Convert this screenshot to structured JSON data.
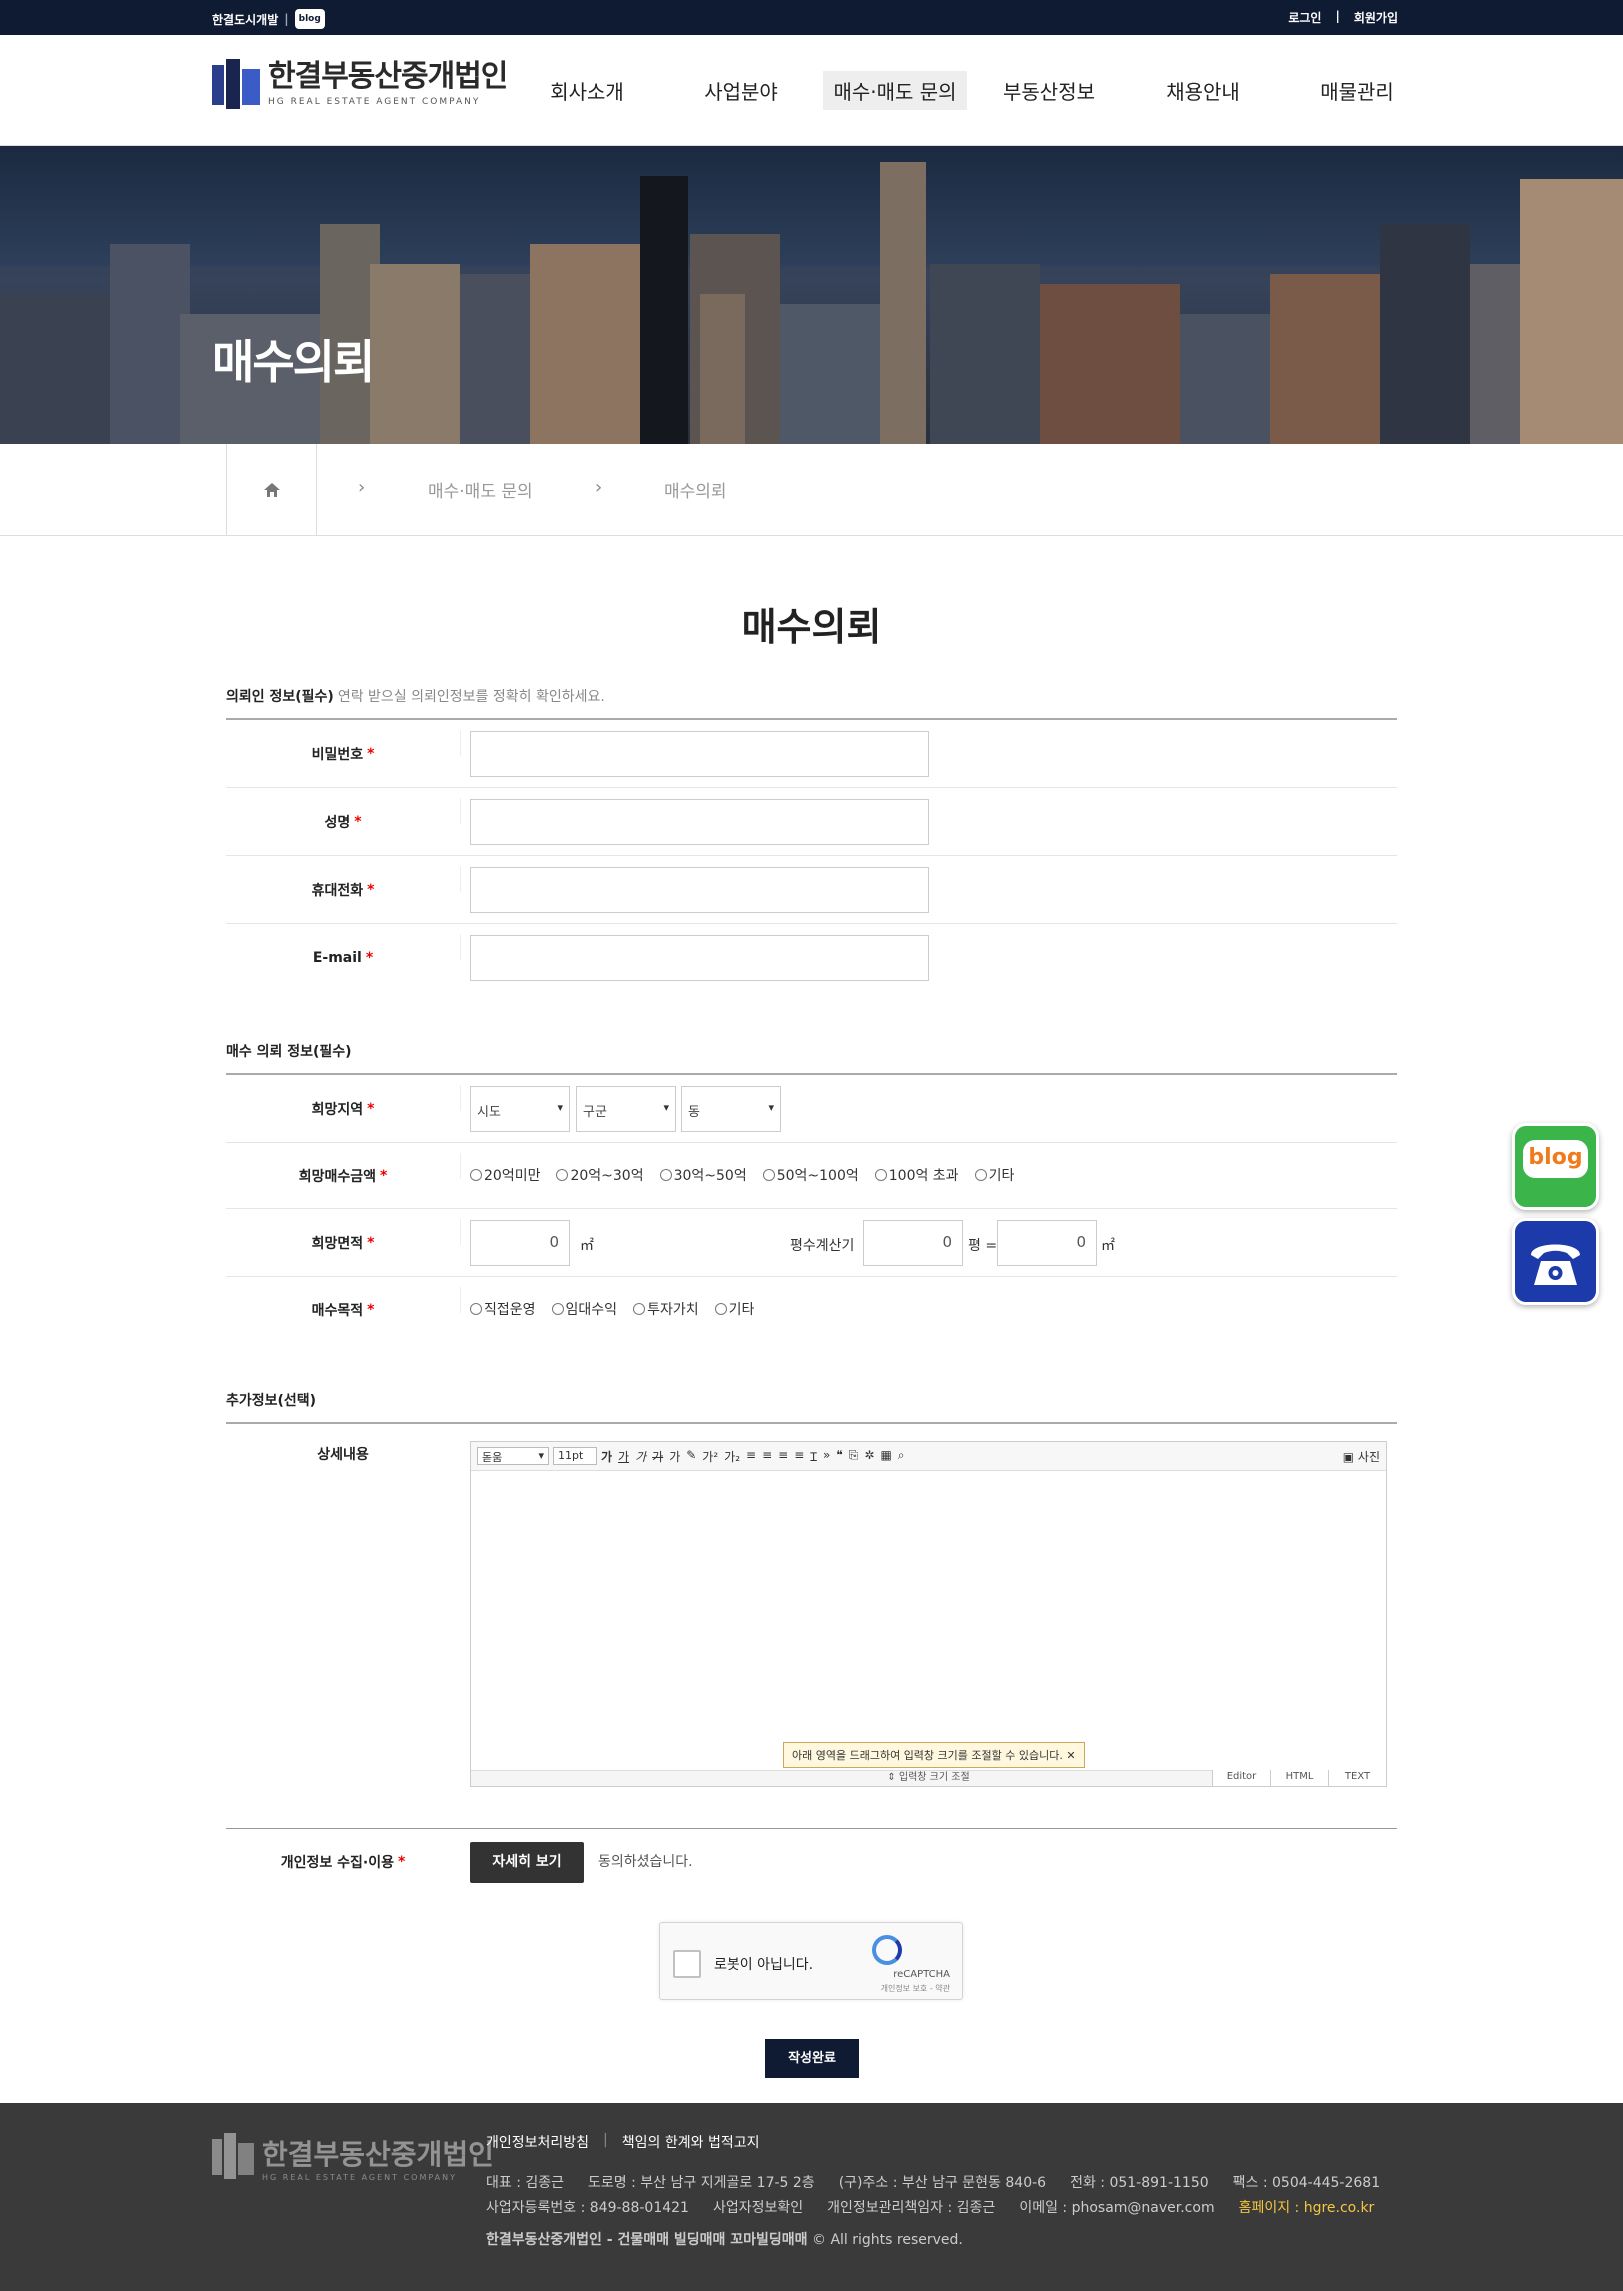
{
  "topbar": {
    "brand": "한결도시개발",
    "blog_chip": "blog",
    "login": "로그인",
    "divider": "|",
    "signup": "회원가입"
  },
  "logo": {
    "ko": "한결부동산중개법인",
    "en": "HG REAL ESTATE AGENT COMPANY"
  },
  "nav": [
    {
      "label": "회사소개"
    },
    {
      "label": "사업분야"
    },
    {
      "label": "매수·매도 문의",
      "active": true
    },
    {
      "label": "부동산정보"
    },
    {
      "label": "채용안내"
    },
    {
      "label": "매물관리"
    }
  ],
  "hero": {
    "title": "매수의뢰"
  },
  "breadcrumb": {
    "level1": "매수·매도 문의",
    "level2": "매수의뢰"
  },
  "page_title": "매수의뢰",
  "section1": {
    "title": "의뢰인 정보(필수)",
    "desc": "연락 받으실 의뢰인정보를 정확히 확인하세요."
  },
  "fields": {
    "password": "비밀번호",
    "name": "성명",
    "phone": "휴대전화",
    "email": "E-mail",
    "required": "*"
  },
  "section2": {
    "title": "매수 의뢰 정보(필수)"
  },
  "region": {
    "label": "희망지역",
    "sido": "시도",
    "gugun": "구군",
    "dong": "동"
  },
  "price": {
    "label": "희망매수금액",
    "options": [
      "20억미만",
      "20억~30억",
      "30억~50억",
      "50억~100억",
      "100억 초과",
      "기타"
    ]
  },
  "area": {
    "label": "희망면적",
    "value": "0",
    "unit": "㎡",
    "calc_label": "평수계산기",
    "pyeong_value": "0",
    "pyeong_unit": "평 =",
    "sqm_value": "0",
    "sqm_unit": "㎡"
  },
  "purpose": {
    "label": "매수목적",
    "options": [
      "직접운영",
      "임대수익",
      "투자가치",
      "기타"
    ]
  },
  "section3": {
    "title": "추가정보(선택)"
  },
  "editor": {
    "label": "상세내용",
    "font": "돋움",
    "size": "11pt",
    "photo": "사진",
    "hint": "아래 영역을 드래그하여 입력창 크기를 조절할 수 있습니다.",
    "resize": "입력창 크기 조절",
    "mode_editor": "Editor",
    "mode_html": "HTML",
    "mode_text": "TEXT"
  },
  "privacy": {
    "label": "개인정보 수집·이용",
    "button": "자세히 보기",
    "agree": "동의하셨습니다."
  },
  "captcha": {
    "label": "로봇이 아닙니다.",
    "brand": "reCAPTCHA",
    "links": "개인정보 보호 - 약관"
  },
  "submit": "작성완료",
  "footer": {
    "link1": "개인정보처리방침",
    "divider": "|",
    "link2": "책임의 한계와 법적고지",
    "ceo": "대표 : 김종근",
    "road": "도로명 : 부산 남구 지게골로 17-5 2층",
    "old": "(구)주소 : 부산 남구 문현동 840-6",
    "tel": "전화 : 051-891-1150",
    "fax": "팩스 : 0504-445-2681",
    "biz": "사업자등록번호 : 849-88-01421",
    "biz_check": "사업자정보확인",
    "privacy_mgr": "개인정보관리책임자 : 김종근",
    "email": "이메일 : phosam@naver.com",
    "homepage": "홈페이지 : hgre.co.kr",
    "copy_bold": "한결부동산중개법인 - 건물매매 빌딩매매 꼬마빌딩매매",
    "copy_rest": "© All rights reserved."
  },
  "floating": {
    "blog": "blog"
  },
  "icons": {
    "home": "home-icon",
    "phone": "phone-icon",
    "refresh": "recaptcha-icon"
  }
}
